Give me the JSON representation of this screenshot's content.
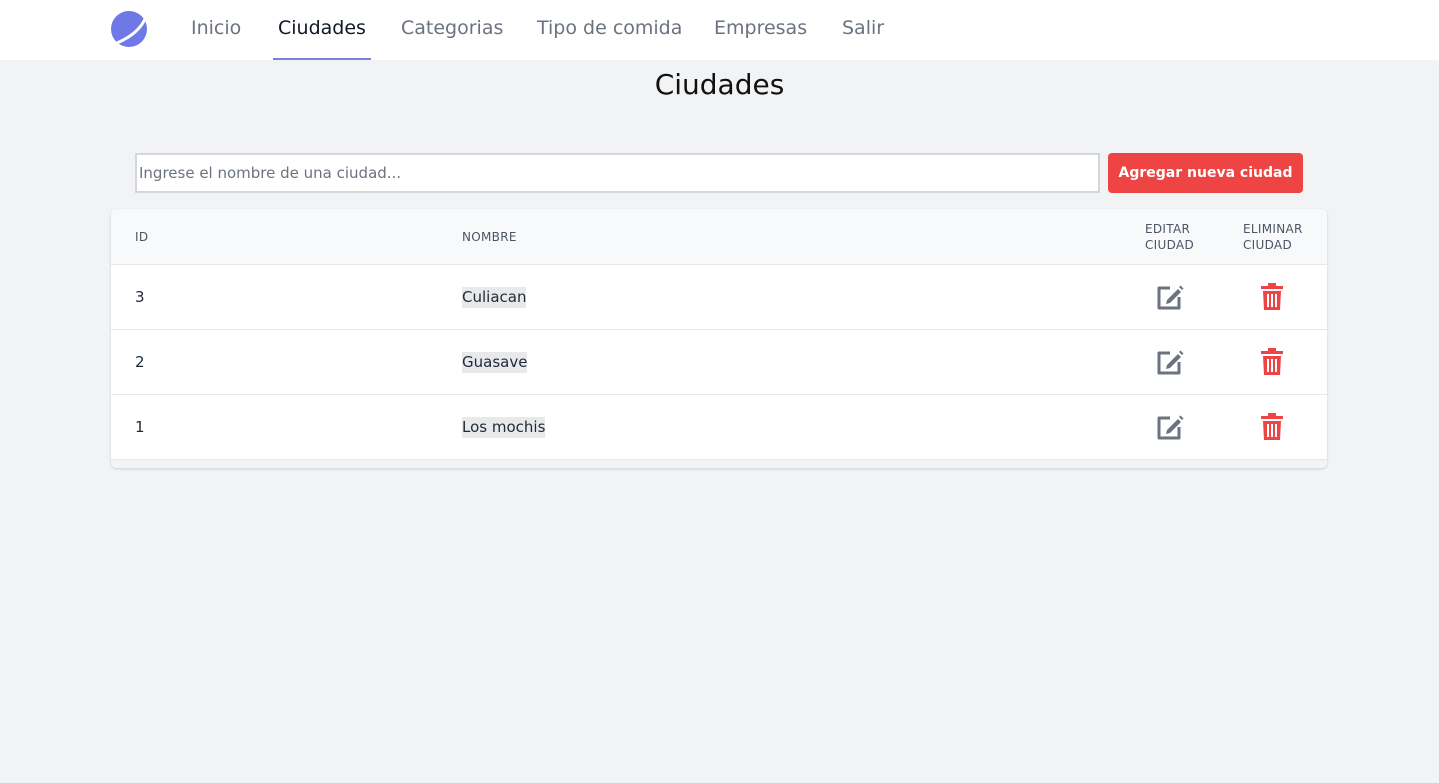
{
  "nav": {
    "items": [
      {
        "label": "Inicio",
        "name": "nav-item-inicio",
        "active": false
      },
      {
        "label": "Ciudades",
        "name": "nav-item-ciudades",
        "active": true
      },
      {
        "label": "Categorias",
        "name": "nav-item-categorias",
        "active": false
      },
      {
        "label": "Tipo de comida",
        "name": "nav-item-tipo-de-comida",
        "active": false
      },
      {
        "label": "Empresas",
        "name": "nav-item-empresas",
        "active": false
      },
      {
        "label": "Salir",
        "name": "nav-item-salir",
        "active": false
      }
    ]
  },
  "page": {
    "title": "Ciudades"
  },
  "search": {
    "placeholder": "Ingrese el nombre de una ciudad...",
    "value": ""
  },
  "add_button": {
    "label": "Agregar nueva ciudad"
  },
  "table": {
    "headers": {
      "id": "ID",
      "name": "NOMBRE",
      "edit_line1": "EDITAR",
      "edit_line2": "CIUDAD",
      "delete_line1": "ELIMINAR",
      "delete_line2": "CIUDAD"
    },
    "rows": [
      {
        "id": "3",
        "name": "Culiacan"
      },
      {
        "id": "2",
        "name": "Guasave"
      },
      {
        "id": "1",
        "name": "Los mochis"
      }
    ]
  },
  "icons": {
    "logo": "logo-icon",
    "edit": "edit-icon",
    "delete": "trash-icon"
  },
  "colors": {
    "accent": "#7b7fe0",
    "danger": "#ef4444",
    "edit_icon": "#6b7280",
    "background": "#f2f3f5"
  }
}
